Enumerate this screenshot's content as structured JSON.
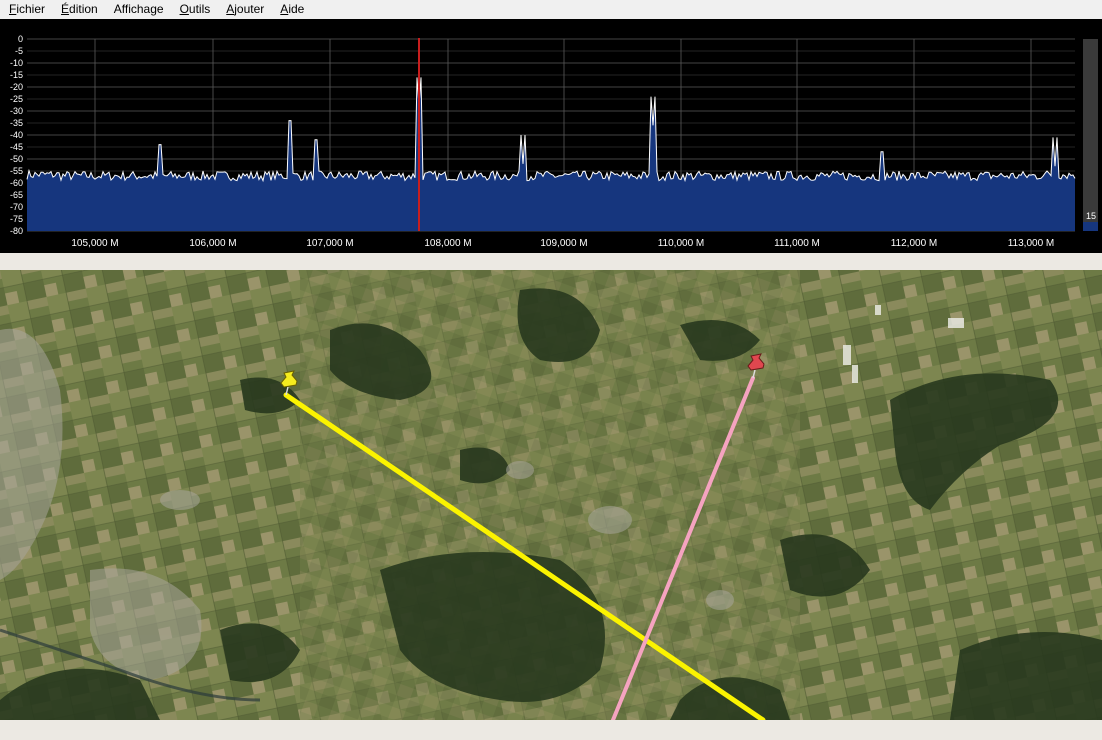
{
  "menu": {
    "items": [
      {
        "accel": "F",
        "rest": "ichier"
      },
      {
        "accel": "É",
        "rest": "dition"
      },
      {
        "accel": "",
        "rest": "Affichage"
      },
      {
        "accel": "O",
        "rest": "utils"
      },
      {
        "accel": "A",
        "rest": "jouter"
      },
      {
        "accel": "A",
        "rest": "ide"
      }
    ]
  },
  "spectrum": {
    "y_labels": [
      "0",
      "-5",
      "-10",
      "-15",
      "-20",
      "-25",
      "-30",
      "-35",
      "-40",
      "-45",
      "-50",
      "-55",
      "-60",
      "-65",
      "-70",
      "-75",
      "-80"
    ],
    "x_labels": [
      "105,000 M",
      "106,000 M",
      "107,000 M",
      "108,000 M",
      "109,000 M",
      "110,000 M",
      "111,000 M",
      "112,000 M",
      "113,000 M"
    ],
    "meter_value": "15",
    "colors": {
      "background": "#000000",
      "grid": "#5a5a5a",
      "fill": "#16367e",
      "trace": "#ffffff",
      "marker": "#c81e1e"
    }
  },
  "map": {
    "markers": [
      {
        "name": "yellow-pushpin-icon",
        "color": "#f5ec1e"
      },
      {
        "name": "red-pushpin-icon",
        "color": "#e0474f"
      }
    ],
    "line_colors": {
      "yellow": "#fbf300",
      "pink": "#f5a3c0"
    }
  }
}
